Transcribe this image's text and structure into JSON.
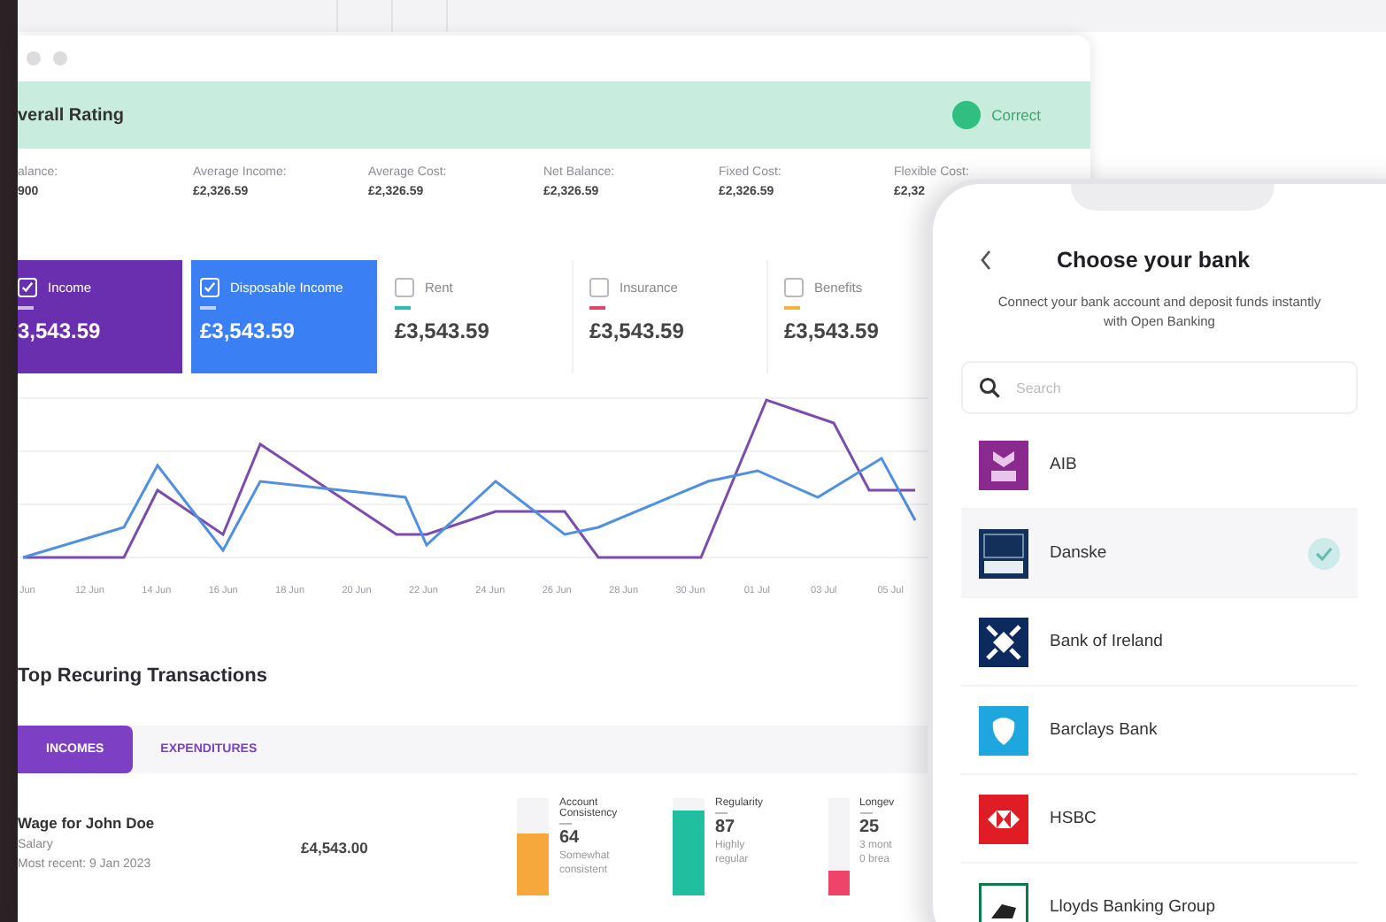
{
  "dashboard": {
    "rating": {
      "title": "verall Rating",
      "status": "Correct"
    },
    "stats": [
      {
        "label": "alance:",
        "value": "900"
      },
      {
        "label": "Average Income:",
        "value": "£2,326.59"
      },
      {
        "label": "Average Cost:",
        "value": "£2,326.59"
      },
      {
        "label": "Net Balance:",
        "value": "£2,326.59"
      },
      {
        "label": "Fixed Cost:",
        "value": "£2,326.59"
      },
      {
        "label": "Flexible Cost:",
        "value": "£2,32"
      }
    ],
    "series_cards": [
      {
        "label": "Income",
        "amount": "3,543.59",
        "checked": true,
        "color": "#6a2fae"
      },
      {
        "label": "Disposable Income",
        "amount": "£3,543.59",
        "checked": true,
        "color": "#3a7ff3"
      },
      {
        "label": "Rent",
        "amount": "£3,543.59",
        "checked": false,
        "color": "#2bbfb0"
      },
      {
        "label": "Insurance",
        "amount": "£3,543.59",
        "checked": false,
        "color": "#e0466a"
      },
      {
        "label": "Benefits",
        "amount": "£3,543.59",
        "checked": false,
        "color": "#f2b53a"
      }
    ],
    "chart": {
      "x_labels": [
        "Jun",
        "12 Jun",
        "14 Jun",
        "16 Jun",
        "18 Jun",
        "20 Jun",
        "22 Jun",
        "24 Jun",
        "26 Jun",
        "28 Jun",
        "30 Jun",
        "01 Jul",
        "03 Jul",
        "05 Jul"
      ]
    },
    "transactions": {
      "title": "Top Recuring Transactions",
      "tabs": [
        {
          "label": "INCOMES",
          "selected": true
        },
        {
          "label": "EXPENDITURES",
          "selected": false
        }
      ],
      "row": {
        "name": "Wage for John Doe",
        "category": "Salary",
        "recent": "Most recent: 9 Jan 2023",
        "amount": "£4,543.00",
        "metrics": [
          {
            "label": "Account Consistency",
            "value": "64",
            "note": [
              "Somewhat",
              "consistent"
            ],
            "level": 0.64,
            "color": "#f7a83a"
          },
          {
            "label": "Regularity",
            "value": "87",
            "note": [
              "Highly",
              "regular"
            ],
            "level": 0.87,
            "color": "#1fbf9f"
          },
          {
            "label": "Longev",
            "value": "25",
            "note": [
              "3 mont",
              "0 brea"
            ],
            "level": 0.25,
            "color": "#f0436a"
          }
        ]
      }
    }
  },
  "phone": {
    "title": "Choose your bank",
    "subtitle": "Connect your bank account and deposit funds instantly with Open Banking",
    "search": {
      "placeholder": "Search"
    },
    "banks": [
      {
        "name": "AIB",
        "selected": false
      },
      {
        "name": "Danske",
        "selected": true
      },
      {
        "name": "Bank of Ireland",
        "selected": false
      },
      {
        "name": "Barclays Bank",
        "selected": false
      },
      {
        "name": "HSBC",
        "selected": false
      },
      {
        "name": "Lloyds Banking Group",
        "selected": false
      }
    ]
  }
}
